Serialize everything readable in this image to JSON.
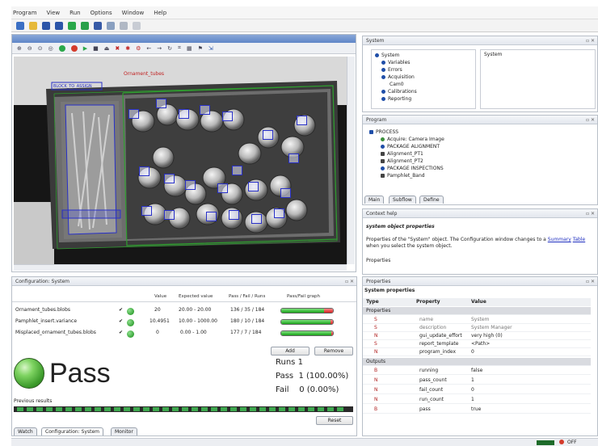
{
  "menu": [
    "Program",
    "View",
    "Run",
    "Options",
    "Window",
    "Help"
  ],
  "image_window": {
    "label_top": "Ornament_tubes",
    "label_left": "BLOCK_TO_ASSIGN"
  },
  "system_panel": {
    "title": "System",
    "tree": [
      "System",
      "Variables",
      "Errors",
      "Acquisition",
      "Cam0",
      "Calibrations",
      "Reporting"
    ],
    "right_label": "System"
  },
  "program_panel": {
    "title": "Program",
    "tree": [
      "PROCESS",
      "Acquire: Camera Image",
      "PACKAGE ALIGNMENT",
      "Alignment_PT1",
      "Alignment_PT2",
      "PACKAGE INSPECTIONS",
      "Pamphlet_Band"
    ],
    "tabs": [
      "Main",
      "Subflow",
      "Define"
    ]
  },
  "context_help": {
    "title": "Context help",
    "heading": "system object properties",
    "body_pre": "Properties of the \"System\" object.  The Configuration window changes to a",
    "link_text": "Summary",
    "link_text2": "Table",
    "body_post": "when you select the system object.",
    "properties_label": "Properties"
  },
  "configuration": {
    "title": "Configuration: System",
    "headers": [
      "Value",
      "Expected value",
      "Pass / Fail / Runs",
      "Pass/Fail graph"
    ],
    "rows": [
      {
        "name": "Ornament_tubes.blobs",
        "value": "20",
        "expected": "20.00 - 20.00",
        "pfr": "136 / 35 / 184",
        "pass_fraction": 0.83
      },
      {
        "name": "Pamphlet_insert.variance",
        "value": "10.4951",
        "expected": "10.00 - 1000.00",
        "pfr": "180 / 10 / 184",
        "pass_fraction": 0.96
      },
      {
        "name": "Misplaced_ornament_tubes.blobs",
        "value": "0",
        "expected": "0.00 - 1.00",
        "pfr": "177 / 7 / 184",
        "pass_fraction": 0.97
      }
    ],
    "add_label": "Add",
    "remove_label": "Remove",
    "status": "Pass",
    "runs_label": "Runs 1",
    "pass_label": "Pass  1 (100.00%)",
    "fail_label": "Fail    0 (0.00%)",
    "previous_results": "Previous results",
    "reset_label": "Reset",
    "tabs": [
      "Watch",
      "Configuration: System",
      "Monitor"
    ]
  },
  "properties": {
    "title": "Properties",
    "section": "System properties",
    "headers": [
      "Type",
      "Property",
      "Value"
    ],
    "groups": [
      {
        "name": "Properties",
        "rows": [
          {
            "type": "S",
            "prop": "name",
            "value": "System"
          },
          {
            "type": "S",
            "prop": "description",
            "value": "System Manager"
          },
          {
            "type": "N",
            "prop": "gui_update_effort",
            "value": "very high (0)"
          },
          {
            "type": "S",
            "prop": "report_template",
            "value": "<Path>"
          },
          {
            "type": "N",
            "prop": "program_index",
            "value": "0"
          }
        ]
      },
      {
        "name": "Outputs",
        "rows": [
          {
            "type": "B",
            "prop": "running",
            "value": "false"
          },
          {
            "type": "N",
            "prop": "pass_count",
            "value": "1"
          },
          {
            "type": "N",
            "prop": "fail_count",
            "value": "0"
          },
          {
            "type": "N",
            "prop": "run_count",
            "value": "1"
          },
          {
            "type": "B",
            "prop": "pass",
            "value": "true"
          }
        ]
      }
    ]
  },
  "statusbar": {
    "right_text": "OFF"
  },
  "colors": {
    "accent": "#2830c8",
    "pass_green": "#1aa31a",
    "fail_red": "#d42020"
  }
}
